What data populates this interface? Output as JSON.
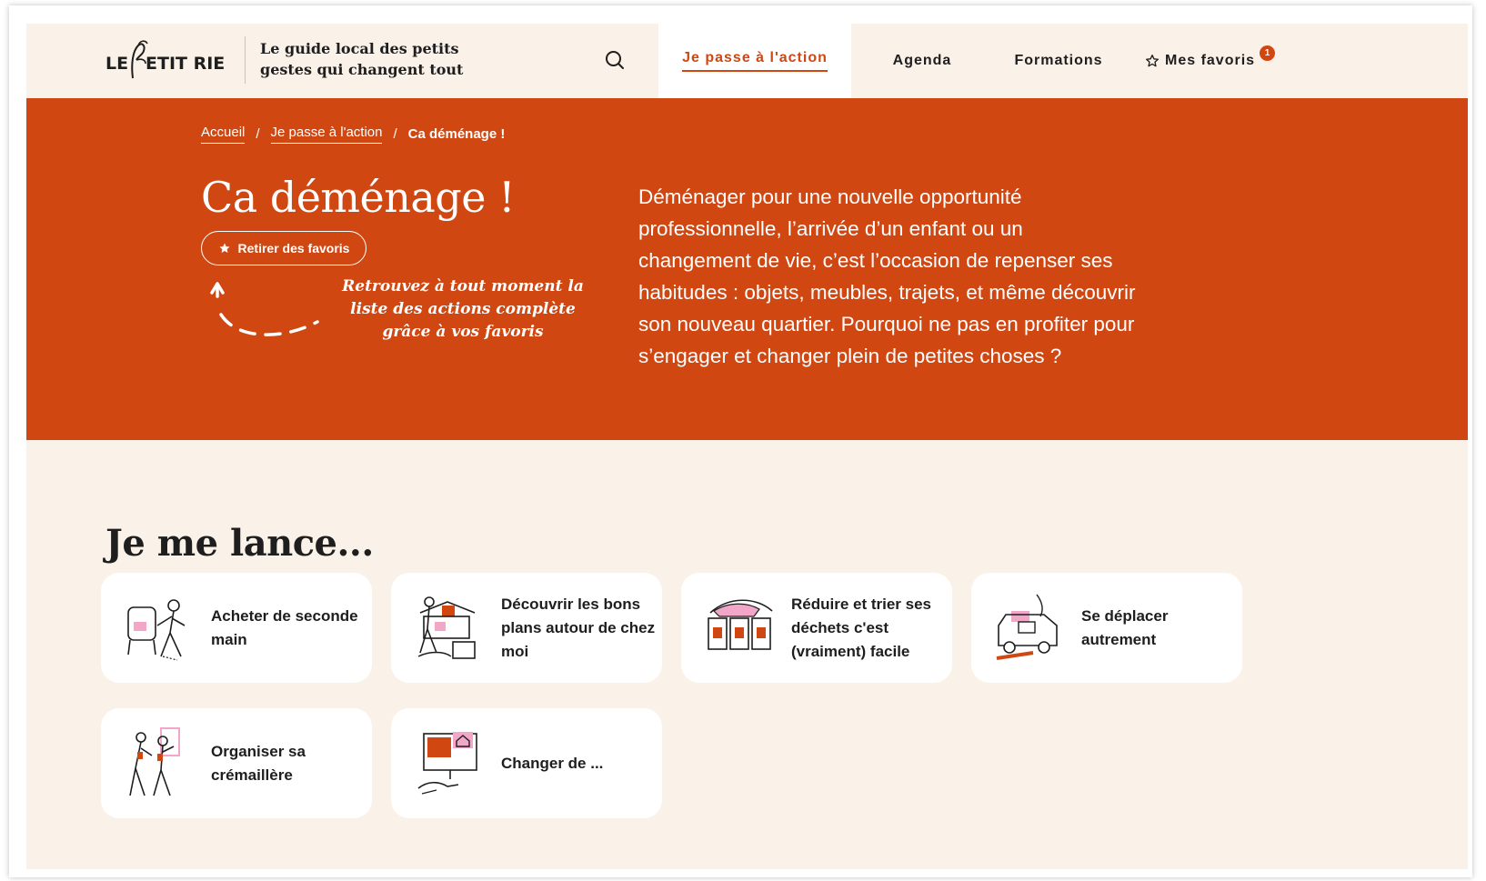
{
  "header": {
    "logo_text": "LE PETIT RIEN",
    "tagline": "Le guide local des petits gestes qui changent tout",
    "nav": {
      "action": "Je passe à l'action",
      "agenda": "Agenda",
      "formations": "Formations",
      "favorites": "Mes favoris",
      "favorites_count": "1"
    }
  },
  "hero": {
    "breadcrumb": {
      "home": "Accueil",
      "parent": "Je passe à l'action",
      "current": "Ca déménage !"
    },
    "title": "Ca déménage !",
    "fav_button": "Retirer des favoris",
    "hint": "Retrouvez à tout moment la liste des actions complète grâce à vos favoris",
    "description": "Déménager pour une nouvelle opportunité professionnelle, l’arrivée d’un enfant ou un changement de vie, c’est l’occasion de repenser ses habitudes : objets, meubles, trajets, et même découvrir son nouveau quartier. Pourquoi ne pas en profiter pour s’engager et changer plein de petites choses ?"
  },
  "section": {
    "title": "Je me lance...",
    "cards": [
      {
        "label": "Acheter de seconde main",
        "icon": "chair-illustration-icon"
      },
      {
        "label": "Découvrir les bons plans autour de chez moi",
        "icon": "market-illustration-icon"
      },
      {
        "label": "Réduire et trier ses déchets c'est (vraiment) facile",
        "icon": "bins-illustration-icon"
      },
      {
        "label": "Se déplacer autrement",
        "icon": "van-illustration-icon"
      },
      {
        "label": "Organiser sa crémaillère",
        "icon": "party-illustration-icon"
      },
      {
        "label": "Changer de ...",
        "icon": "screen-illustration-icon"
      }
    ]
  },
  "colors": {
    "accent": "#d04712",
    "background": "#faf1e8",
    "card": "#ffffff",
    "text": "#1e1e1e",
    "illustration_pink": "#f2a7c8"
  }
}
